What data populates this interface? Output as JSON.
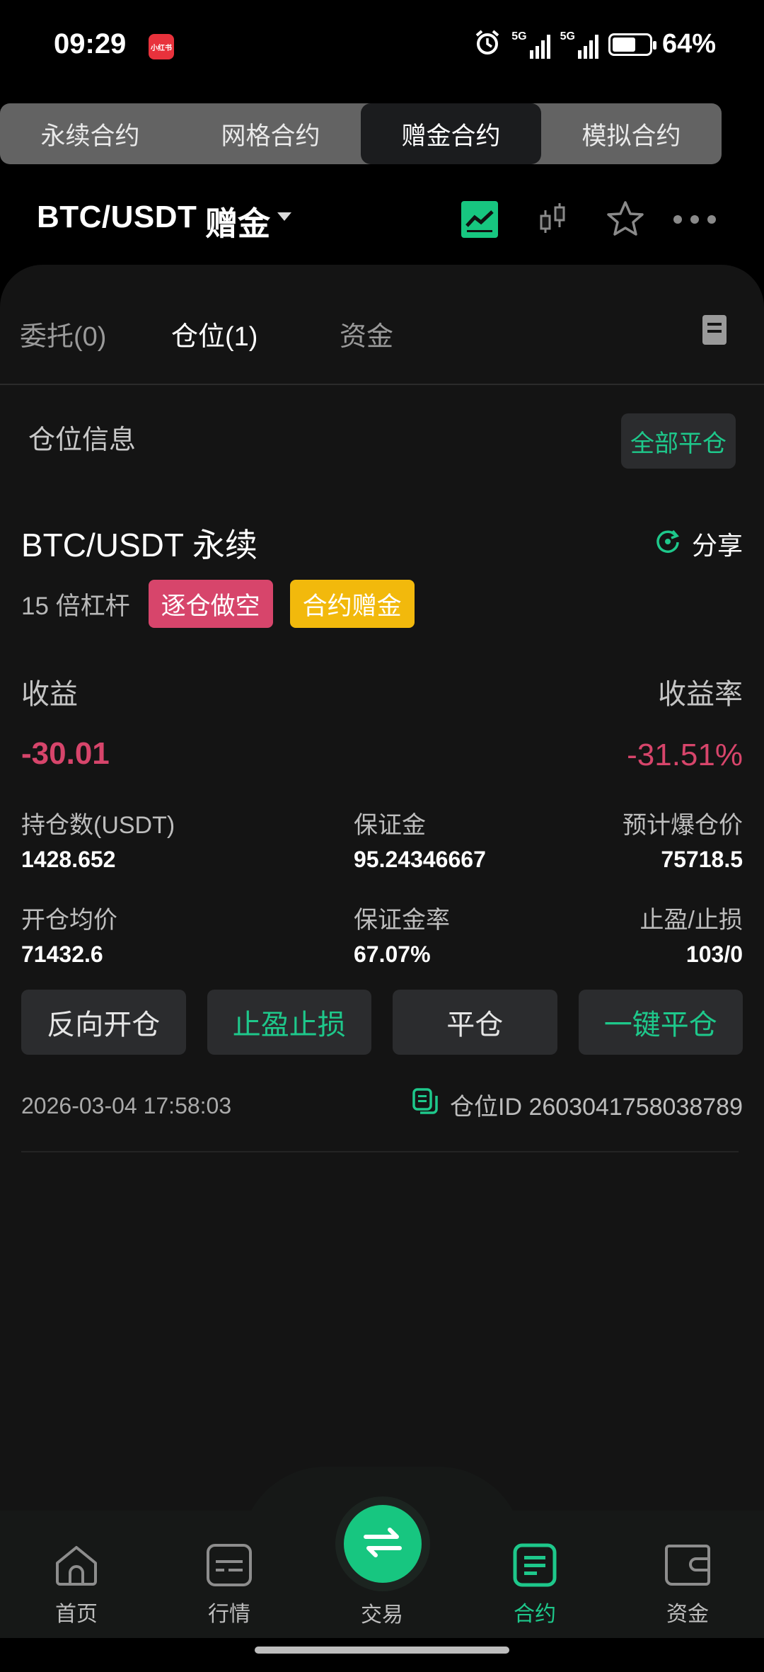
{
  "status_bar": {
    "time": "09:29",
    "app_badge": "小红书",
    "network1": "5G",
    "network2": "5G",
    "battery_percent": "64%",
    "battery_level": 0.64
  },
  "top_tabs": [
    {
      "label": "永续合约",
      "active": false
    },
    {
      "label": "网格合约",
      "active": false
    },
    {
      "label": "赠金合约",
      "active": true
    },
    {
      "label": "模拟合约",
      "active": false
    }
  ],
  "header": {
    "pair": "BTC/USDT",
    "tag": "赠金",
    "icons": [
      "chart-toggle-icon",
      "candlestick-icon",
      "star-icon",
      "more-icon"
    ]
  },
  "sub_tabs": [
    {
      "label": "委托(0)",
      "active": false
    },
    {
      "label": "仓位(1)",
      "active": true
    },
    {
      "label": "资金",
      "active": false
    }
  ],
  "position_section": {
    "title": "仓位信息",
    "close_all_label": "全部平仓"
  },
  "position": {
    "title": "BTC/USDT 永续",
    "share_label": "分享",
    "leverage": "15 倍杠杆",
    "badge_side": "逐仓做空",
    "badge_bonus": "合约赠金",
    "pnl_label": "收益",
    "pnl_rate_label": "收益率",
    "pnl_value": "-30.01",
    "pnl_rate_value": "-31.51%",
    "size_label": "持仓数(USDT)",
    "size_value": "1428.652",
    "margin_label": "保证金",
    "margin_value": "95.24346667",
    "liq_label": "预计爆仓价",
    "liq_value": "75718.5",
    "entry_label": "开仓均价",
    "entry_value": "71432.6",
    "margin_rate_label": "保证金率",
    "margin_rate_value": "67.07%",
    "tpsl_label": "止盈/止损",
    "tpsl_value": "103/0",
    "buttons": {
      "reverse": "反向开仓",
      "tpsl": "止盈止损",
      "close": "平仓",
      "quick_close": "一键平仓"
    },
    "timestamp": "2026-03-04 17:58:03",
    "position_id": "仓位ID 2603041758038789"
  },
  "bottom_nav": {
    "home": "首页",
    "market": "行情",
    "trade": "交易",
    "contract": "合约",
    "assets": "资金"
  },
  "colors": {
    "accent_green": "#1ec88b",
    "loss_red": "#d7456b",
    "bonus_gold": "#f2b90c"
  }
}
